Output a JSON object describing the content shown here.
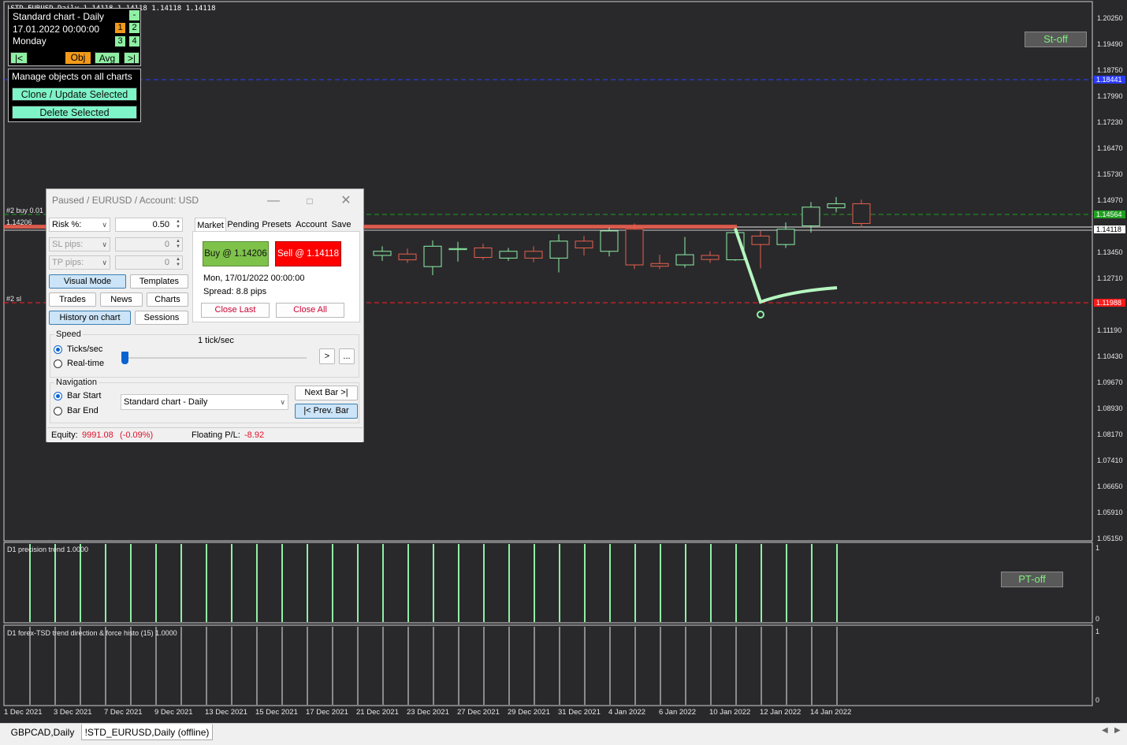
{
  "symbol_header": "!STD_EURUSD,Daily  1.14118 1.14118 1.14118 1.14118",
  "info_panel": {
    "chart_name": "Standard chart - Daily",
    "date_time": "17.01.2022   00:00:00",
    "weekday": "Monday",
    "minus": "-",
    "n1": "1",
    "n2": "2",
    "n3": "3",
    "n4": "4",
    "first_btn": "|<",
    "obj_btn": "Obj",
    "avg_btn": "Avg",
    "last_btn": ">|"
  },
  "objects_panel": {
    "title": "Manage objects on all charts",
    "clone_btn": "Clone / Update Selected",
    "delete_btn": "Delete Selected"
  },
  "tester": {
    "title": "Paused / EURUSD / Account: USD",
    "risk_label": "Risk %:",
    "risk_value": "0.50",
    "sl_label": "SL pips:",
    "sl_value": "0",
    "tp_label": "TP pips:",
    "tp_value": "0",
    "visual_mode": "Visual Mode",
    "templates": "Templates",
    "trades": "Trades",
    "news": "News",
    "charts": "Charts",
    "history": "History on chart",
    "sessions": "Sessions",
    "tabs": [
      "Market",
      "Pending",
      "Presets",
      "Account",
      "Save"
    ],
    "buy_btn": "Buy @ 1.14206",
    "sell_btn": "Sell @ 1.14118",
    "time_text": "Mon, 17/01/2022  00:00:00",
    "spread_text": "Spread: 8.8 pips",
    "close_last": "Close Last",
    "close_all": "Close All",
    "speed_title": "Speed",
    "speed_value": "1 tick/sec",
    "ticks_sec": "Ticks/sec",
    "realtime": "Real-time",
    "play_btn": ">",
    "more_btn": "...",
    "nav_title": "Navigation",
    "bar_start": "Bar Start",
    "bar_end": "Bar End",
    "chart_select": "Standard chart - Daily",
    "next_bar": "Next Bar >|",
    "prev_bar": "|< Prev. Bar",
    "equity_label": "Equity:",
    "equity_value": "9991.08",
    "equity_pct": "(-0.09%)",
    "floating_label": "Floating P/L:",
    "floating_value": "-8.92"
  },
  "chart_labels": {
    "buy_line": "#2 buy 0.01",
    "buy_price": "1.14206",
    "sl_line": "#2 sl",
    "st_off": "St-off",
    "pt_off": "PT-off",
    "pane1": "D1 precision trend 1.0000",
    "pane2": "D1 forex-TSD trend direction & force histo (15) 1.0000",
    "pane1_top": "1",
    "pane1_bottom": "0",
    "pane2_top": "1",
    "pane2_bottom": "0"
  },
  "price_axis": [
    "1.20250",
    "1.19490",
    "1.18750",
    "1.17990",
    "1.17230",
    "1.16470",
    "1.15730",
    "1.14970",
    "1.13450",
    "1.12710",
    "1.11190",
    "1.10430",
    "1.09670",
    "1.08930",
    "1.08170",
    "1.07410",
    "1.06650",
    "1.05910",
    "1.05150"
  ],
  "price_tags": {
    "blue": "1.18441",
    "green": "1.14564",
    "white": "1.14118",
    "red": "1.11988"
  },
  "date_axis": [
    "1 Dec 2021",
    "3 Dec 2021",
    "7 Dec 2021",
    "9 Dec 2021",
    "13 Dec 2021",
    "15 Dec 2021",
    "17 Dec 2021",
    "21 Dec 2021",
    "23 Dec 2021",
    "27 Dec 2021",
    "29 Dec 2021",
    "31 Dec 2021",
    "4 Jan 2022",
    "6 Jan 2022",
    "10 Jan 2022",
    "12 Jan 2022",
    "14 Jan 2022"
  ],
  "chart_tabs": [
    "GBPCAD,Daily",
    "!STD_EURUSD,Daily (offline)"
  ],
  "colors": {
    "bull": "#8ff0a4",
    "bear": "#e8604c",
    "background": "#29292c"
  },
  "chart_data": {
    "type": "candlestick",
    "ylim": [
      1.0478,
      1.2065
    ],
    "candles": [
      {
        "o": 1.1318,
        "h": 1.1345,
        "l": 1.1302,
        "c": 1.133
      },
      {
        "o": 1.1322,
        "h": 1.1338,
        "l": 1.1296,
        "c": 1.1305
      },
      {
        "o": 1.1285,
        "h": 1.1362,
        "l": 1.126,
        "c": 1.1345
      },
      {
        "o": 1.1335,
        "h": 1.1358,
        "l": 1.13,
        "c": 1.1338
      },
      {
        "o": 1.134,
        "h": 1.1352,
        "l": 1.1305,
        "c": 1.1312
      },
      {
        "o": 1.131,
        "h": 1.134,
        "l": 1.1302,
        "c": 1.133
      },
      {
        "o": 1.133,
        "h": 1.1345,
        "l": 1.1298,
        "c": 1.131
      },
      {
        "o": 1.131,
        "h": 1.138,
        "l": 1.1268,
        "c": 1.136
      },
      {
        "o": 1.136,
        "h": 1.1375,
        "l": 1.1318,
        "c": 1.134
      },
      {
        "o": 1.133,
        "h": 1.14,
        "l": 1.1315,
        "c": 1.139
      },
      {
        "o": 1.1395,
        "h": 1.1412,
        "l": 1.1278,
        "c": 1.129
      },
      {
        "o": 1.1294,
        "h": 1.132,
        "l": 1.1278,
        "c": 1.1286
      },
      {
        "o": 1.129,
        "h": 1.1372,
        "l": 1.1282,
        "c": 1.132
      },
      {
        "o": 1.1318,
        "h": 1.133,
        "l": 1.1296,
        "c": 1.1306
      },
      {
        "o": 1.1305,
        "h": 1.14,
        "l": 1.1302,
        "c": 1.1385
      },
      {
        "o": 1.1375,
        "h": 1.139,
        "l": 1.128,
        "c": 1.135
      },
      {
        "o": 1.135,
        "h": 1.1415,
        "l": 1.134,
        "c": 1.1395
      },
      {
        "o": 1.1405,
        "h": 1.1475,
        "l": 1.1385,
        "c": 1.146
      },
      {
        "o": 1.1458,
        "h": 1.149,
        "l": 1.1445,
        "c": 1.147
      },
      {
        "o": 1.147,
        "h": 1.1482,
        "l": 1.14,
        "c": 1.1412
      }
    ]
  }
}
